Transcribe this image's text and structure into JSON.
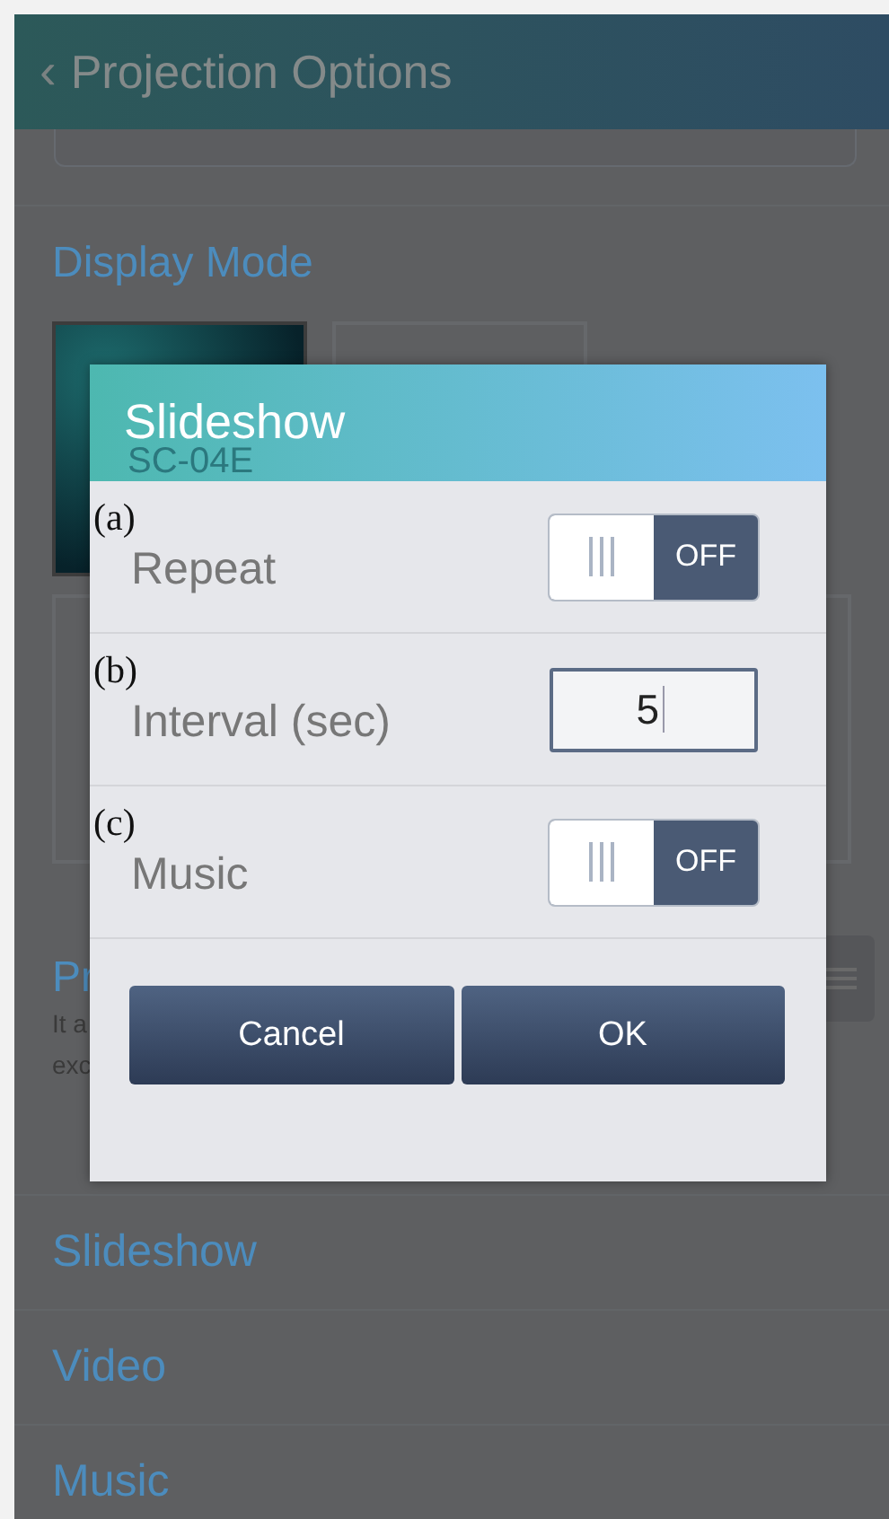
{
  "header": {
    "back_icon": "‹",
    "title": "Projection Options"
  },
  "display_mode": {
    "heading": "Display Mode",
    "thumbnails": [
      {
        "label": "SC-04E",
        "selected": true
      },
      {
        "selected": false
      }
    ]
  },
  "partial_section": {
    "heading": "Pr",
    "description_lines": [
      "It a",
      "exc"
    ]
  },
  "menu_items": [
    {
      "label": "Slideshow"
    },
    {
      "label": "Video"
    },
    {
      "label": "Music"
    }
  ],
  "dialog": {
    "title": "Slideshow",
    "rows": [
      {
        "kind": "toggle",
        "marker": "(a)",
        "label": "Repeat",
        "on": false,
        "state_text": "OFF"
      },
      {
        "kind": "number",
        "marker": "(b)",
        "label": "Interval (sec)",
        "value": "5"
      },
      {
        "kind": "toggle",
        "marker": "(c)",
        "label": "Music",
        "on": false,
        "state_text": "OFF"
      }
    ],
    "buttons": [
      "Cancel",
      "OK"
    ]
  }
}
